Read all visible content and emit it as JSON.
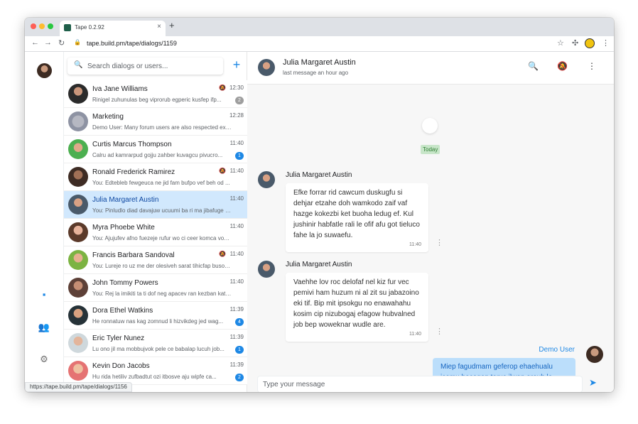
{
  "browser": {
    "tab_title": "Tape 0.2.92",
    "tab_close": "×",
    "new_tab": "+",
    "back": "←",
    "forward": "→",
    "reload": "↻",
    "lock": "🔒",
    "url": "tape.build.pm/tape/dialogs/1159",
    "star": "☆",
    "extensions": "✣",
    "menu": "⋮",
    "status_url": "https://tape.build.pm/tape/dialogs/1156"
  },
  "rail": {
    "icons": [
      "chat-icon",
      "people-icon",
      "gear-icon",
      "exit-icon"
    ],
    "chat_glyph": "▪",
    "people_glyph": "👥",
    "gear_glyph": "⚙",
    "exit_glyph": "▮"
  },
  "search": {
    "icon": "🔍",
    "placeholder": "Search dialogs or users...",
    "add_label": "+"
  },
  "dialogs": [
    {
      "name": "Iva Jane Williams",
      "snippet": "Rinigel zuhunulas beg viprorub egperic kusfep ifp...",
      "time": "12:30",
      "muted": true,
      "badge": "2",
      "badge_color": "grey"
    },
    {
      "name": "Marketing",
      "snippet": "Demo User: Many forum users are also respected expert...",
      "time": "12:28",
      "muted": false,
      "badge": "",
      "badge_color": ""
    },
    {
      "name": "Curtis Marcus Thompson",
      "snippet": "Calru ad kamrarpud gojju zahber kuvagcu pivucro...",
      "time": "11:40",
      "muted": false,
      "badge": "1",
      "badge_color": "blue"
    },
    {
      "name": "Ronald Frederick Ramirez",
      "snippet": "You: Edtebleb fewgeuca ne jid fam bufpo vef beh od ...",
      "time": "11:40",
      "muted": true,
      "badge": "",
      "badge_color": ""
    },
    {
      "name": "Julia Margaret Austin",
      "snippet": "You: Pinludlo diad davajuw ucuumi ba ri ma jibafuge afs...",
      "time": "11:40",
      "muted": false,
      "badge": "",
      "badge_color": ""
    },
    {
      "name": "Myra Phoebe White",
      "snippet": "You: Ajujufev afno fuezeje rufur wo ci ceer komca vovtol ...",
      "time": "11:40",
      "muted": false,
      "badge": "",
      "badge_color": ""
    },
    {
      "name": "Francis Barbara Sandoval",
      "snippet": "You: Lureje ro uz me der olesiveh sarat tihicfap buso ma ...",
      "time": "11:40",
      "muted": true,
      "badge": "",
      "badge_color": ""
    },
    {
      "name": "John Tommy Powers",
      "snippet": "You: Rej la imikiti ta ti dof neg apacev ran kezban katuvi...",
      "time": "11:40",
      "muted": false,
      "badge": "",
      "badge_color": ""
    },
    {
      "name": "Dora Ethel Watkins",
      "snippet": "He ronnatuw nas kag zomnud li hizvikdeg jed wag...",
      "time": "11:39",
      "muted": false,
      "badge": "4",
      "badge_color": "blue"
    },
    {
      "name": "Eric Tyler Nunez",
      "snippet": "Lu ono jil ma mobbujvok pele ce babalap lucuh job...",
      "time": "11:39",
      "muted": false,
      "badge": "1",
      "badge_color": "blue"
    },
    {
      "name": "Kevin Don Jacobs",
      "snippet": "Hu rida hetiliv zufbadtut ozi itbosve aju wipfe ca...",
      "time": "11:39",
      "muted": false,
      "badge": "2",
      "badge_color": "blue"
    }
  ],
  "mute_glyph": "🔕",
  "chat": {
    "title": "Julia Margaret Austin",
    "status": "last message an hour ago",
    "search_icon": "🔍",
    "mute_icon": "🔕",
    "menu_icon": "⋮",
    "date_divider": "Today",
    "messages": [
      {
        "author": "Julia Margaret Austin",
        "text": "Efke forrar rid cawcum duskugfu si dehjar etzahe doh wamkodo zaif vaf hazge kokezbi ket buoha ledug ef. Kul jushinir habfatle rali le ofif afu got tieluco fahe la jo suwaefu.",
        "time": "11:40"
      },
      {
        "author": "Julia Margaret Austin",
        "text": "Vaehhe lov roc delofaf nel kiz fur vec pemivi ham huzum ni al zit su jabazoino eki tif. Bip mit ipsokgu no enawahahu kosim cip nizubogaj efagow hubvalned job bep woweknar wudle are.",
        "time": "11:40"
      }
    ],
    "more_icon": "⋮",
    "own_author": "Demo User",
    "own_text": "Miep fagudmam geferop ehaehualu icemu hocoqop terus ilwop oroub le",
    "composer_placeholder": "Type your message",
    "send_icon": "➤"
  }
}
